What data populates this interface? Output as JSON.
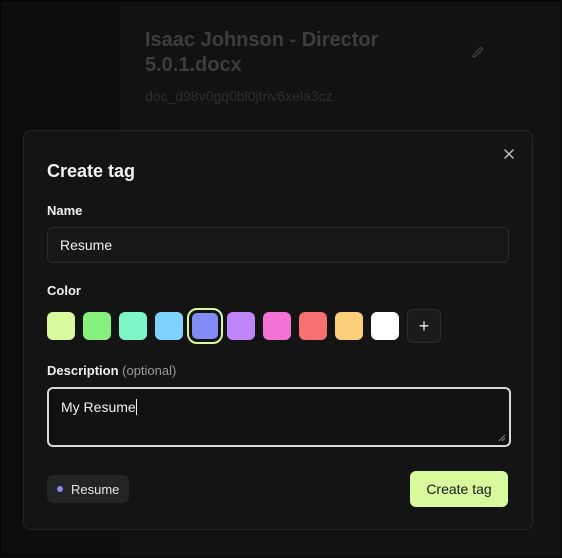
{
  "background": {
    "doc_title": "Isaac Johnson - Director 5.0.1.docx",
    "doc_id": "doc_d98v0gq0bl0jtriv6xela3cz",
    "edit_icon": "pencil-icon"
  },
  "modal": {
    "title": "Create tag",
    "close_icon": "close-icon",
    "name_label": "Name",
    "name_value": "Resume",
    "color_label": "Color",
    "colors": [
      "#d9f99d",
      "#86ef7d",
      "#7ef5c7",
      "#7dd3fc",
      "#818cf8",
      "#c084fc",
      "#f472d6",
      "#f87171",
      "#fcd07a",
      "#ffffff"
    ],
    "selected_color": "#818cf8",
    "add_color_icon": "plus-icon",
    "description_label": "Description",
    "description_optional": "(optional)",
    "description_value": "My Resume",
    "preview_label": "Resume",
    "create_button": "Create tag"
  }
}
